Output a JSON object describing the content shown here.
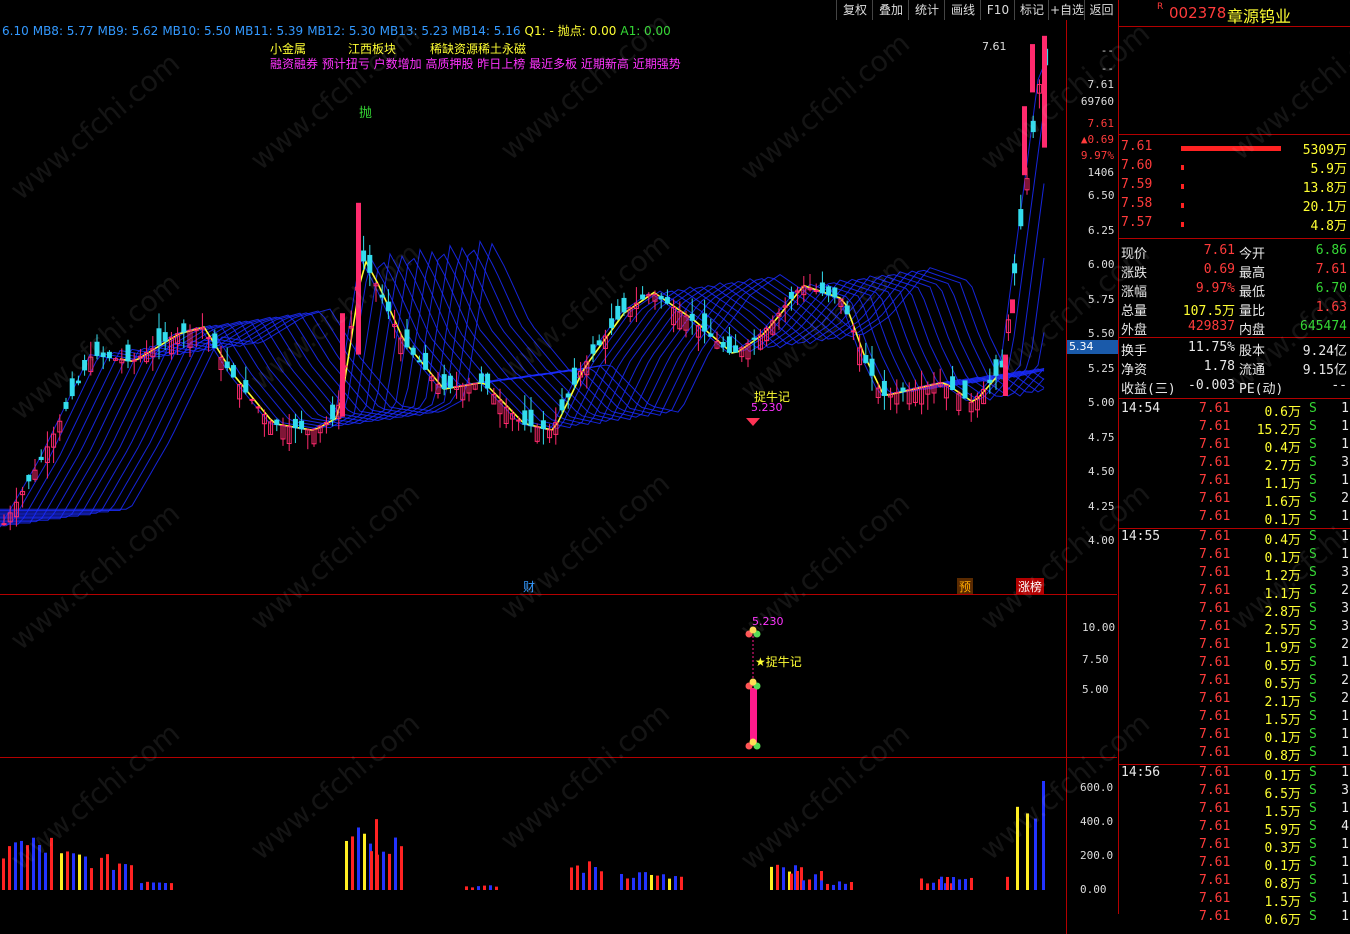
{
  "toolbar": {
    "buttons": [
      "复权",
      "叠加",
      "统计",
      "画线",
      "F10",
      "标记",
      "+自选",
      "返回"
    ]
  },
  "ma_legend": [
    {
      "label": "6.10",
      "color": "#3399ff"
    },
    {
      "label": "MB8: 5.77",
      "color": "#3399ff"
    },
    {
      "label": "MB9: 5.62",
      "color": "#3399ff"
    },
    {
      "label": "MB10: 5.50",
      "color": "#3399ff"
    },
    {
      "label": "MB11: 5.39",
      "color": "#3399ff"
    },
    {
      "label": "MB12: 5.30",
      "color": "#3399ff"
    },
    {
      "label": "MB13: 5.23",
      "color": "#3399ff"
    },
    {
      "label": "MB14: 5.16",
      "color": "#3399ff"
    },
    {
      "label": "Q1: -",
      "color": "#ffff33"
    },
    {
      "label": "抛点: 0.00",
      "color": "#ffff33"
    },
    {
      "label": "A1: 0.00",
      "color": "#35d835"
    }
  ],
  "tags_line1": [
    "小金属",
    "江西板块",
    "稀缺资源",
    "稀土永磁"
  ],
  "tags_line2": "融资融券 预计扭亏 户数增加 高质押股 昨日上榜 最近多板 近期新高 近期强势",
  "annotations": {
    "sell_mark": "抛",
    "catch_bull": "捉牛记",
    "catch_bull_price": "5.230",
    "finance_mark": "财",
    "forecast_mark": "预",
    "limit_up_list": "涨榜",
    "top_price_marker": "7.61",
    "sub_catch_bull": "★捉牛记",
    "sub_price": "5.230"
  },
  "price_axis": {
    "top_values": [
      "--",
      "--",
      "7.61",
      "69760",
      "7.61",
      "▲0.69",
      "9.97%",
      "1406"
    ],
    "ticks": [
      "6.50",
      "6.25",
      "6.00",
      "5.75",
      "5.50",
      "5.25",
      "5.00",
      "4.75",
      "4.50",
      "4.25",
      "4.00"
    ],
    "current_tag": "5.34"
  },
  "sub_axis": {
    "ticks": [
      "10.00",
      "7.50",
      "5.00"
    ]
  },
  "vol_axis": {
    "ticks": [
      "600.0",
      "400.0",
      "200.0",
      "0.00"
    ]
  },
  "stock": {
    "badge": "R",
    "code": "002378",
    "name": "章源钨业"
  },
  "order_book": [
    {
      "price": "7.61",
      "volume": "5309万",
      "bar": 1.0
    },
    {
      "price": "7.60",
      "volume": "5.9万",
      "bar": 0.01
    },
    {
      "price": "7.59",
      "volume": "13.8万",
      "bar": 0.02
    },
    {
      "price": "7.58",
      "volume": "20.1万",
      "bar": 0.02
    },
    {
      "price": "7.57",
      "volume": "4.8万",
      "bar": 0.01
    }
  ],
  "quote": [
    {
      "k1": "现价",
      "v1": "7.61",
      "c1": "red",
      "k2": "今开",
      "v2": "6.86",
      "c2": "green"
    },
    {
      "k1": "涨跌",
      "v1": "0.69",
      "c1": "red",
      "k2": "最高",
      "v2": "7.61",
      "c2": "red"
    },
    {
      "k1": "涨幅",
      "v1": "9.97%",
      "c1": "red",
      "k2": "最低",
      "v2": "6.70",
      "c2": "green"
    },
    {
      "k1": "总量",
      "v1": "107.5万",
      "c1": "yellow",
      "k2": "量比",
      "v2": "1.63",
      "c2": "red"
    },
    {
      "k1": "外盘",
      "v1": "429837",
      "c1": "red",
      "k2": "内盘",
      "v2": "645474",
      "c2": "green"
    },
    {
      "k1": "换手",
      "v1": "11.75%",
      "c1": "white",
      "k2": "股本",
      "v2": "9.24亿",
      "c2": "white"
    },
    {
      "k1": "净资",
      "v1": "1.78",
      "c1": "white",
      "k2": "流通",
      "v2": "9.15亿",
      "c2": "white"
    },
    {
      "k1": "收益(三)",
      "v1": "-0.003",
      "c1": "white",
      "k2": "PE(动)",
      "v2": "--",
      "c2": "white"
    }
  ],
  "ticks": [
    {
      "time": "14:54",
      "price": "7.61",
      "vol": "0.6万",
      "side": "S",
      "n": "1"
    },
    {
      "time": "",
      "price": "7.61",
      "vol": "15.2万",
      "side": "S",
      "n": "1"
    },
    {
      "time": "",
      "price": "7.61",
      "vol": "0.4万",
      "side": "S",
      "n": "1"
    },
    {
      "time": "",
      "price": "7.61",
      "vol": "2.7万",
      "side": "S",
      "n": "3"
    },
    {
      "time": "",
      "price": "7.61",
      "vol": "1.1万",
      "side": "S",
      "n": "1"
    },
    {
      "time": "",
      "price": "7.61",
      "vol": "1.6万",
      "side": "S",
      "n": "2"
    },
    {
      "time": "",
      "price": "7.61",
      "vol": "0.1万",
      "side": "S",
      "n": "1"
    },
    {
      "time": "14:55",
      "price": "7.61",
      "vol": "0.4万",
      "side": "S",
      "n": "1"
    },
    {
      "time": "",
      "price": "7.61",
      "vol": "0.1万",
      "side": "S",
      "n": "1"
    },
    {
      "time": "",
      "price": "7.61",
      "vol": "1.2万",
      "side": "S",
      "n": "3"
    },
    {
      "time": "",
      "price": "7.61",
      "vol": "1.1万",
      "side": "S",
      "n": "2"
    },
    {
      "time": "",
      "price": "7.61",
      "vol": "2.8万",
      "side": "S",
      "n": "3"
    },
    {
      "time": "",
      "price": "7.61",
      "vol": "2.5万",
      "side": "S",
      "n": "3"
    },
    {
      "time": "",
      "price": "7.61",
      "vol": "1.9万",
      "side": "S",
      "n": "2"
    },
    {
      "time": "",
      "price": "7.61",
      "vol": "0.5万",
      "side": "S",
      "n": "1"
    },
    {
      "time": "",
      "price": "7.61",
      "vol": "0.5万",
      "side": "S",
      "n": "2"
    },
    {
      "time": "",
      "price": "7.61",
      "vol": "2.1万",
      "side": "S",
      "n": "2"
    },
    {
      "time": "",
      "price": "7.61",
      "vol": "1.5万",
      "side": "S",
      "n": "1"
    },
    {
      "time": "",
      "price": "7.61",
      "vol": "0.1万",
      "side": "S",
      "n": "1"
    },
    {
      "time": "",
      "price": "7.61",
      "vol": "0.8万",
      "side": "S",
      "n": "1"
    },
    {
      "time": "14:56",
      "price": "7.61",
      "vol": "0.1万",
      "side": "S",
      "n": "1"
    },
    {
      "time": "",
      "price": "7.61",
      "vol": "6.5万",
      "side": "S",
      "n": "3"
    },
    {
      "time": "",
      "price": "7.61",
      "vol": "1.5万",
      "side": "S",
      "n": "1"
    },
    {
      "time": "",
      "price": "7.61",
      "vol": "5.9万",
      "side": "S",
      "n": "4"
    },
    {
      "time": "",
      "price": "7.61",
      "vol": "0.3万",
      "side": "S",
      "n": "1"
    },
    {
      "time": "",
      "price": "7.61",
      "vol": "0.1万",
      "side": "S",
      "n": "1"
    },
    {
      "time": "",
      "price": "7.61",
      "vol": "0.8万",
      "side": "S",
      "n": "1"
    },
    {
      "time": "",
      "price": "7.61",
      "vol": "1.5万",
      "side": "S",
      "n": "1"
    },
    {
      "time": "",
      "price": "7.61",
      "vol": "0.6万",
      "side": "S",
      "n": "1"
    }
  ],
  "watermark": "www.cfchi.com",
  "colors": {
    "up": "#ff2a6d",
    "down": "#33ddee",
    "ribbon": "#1a2bff",
    "ma_short": "#ffff33",
    "separator": "#b30000"
  }
}
